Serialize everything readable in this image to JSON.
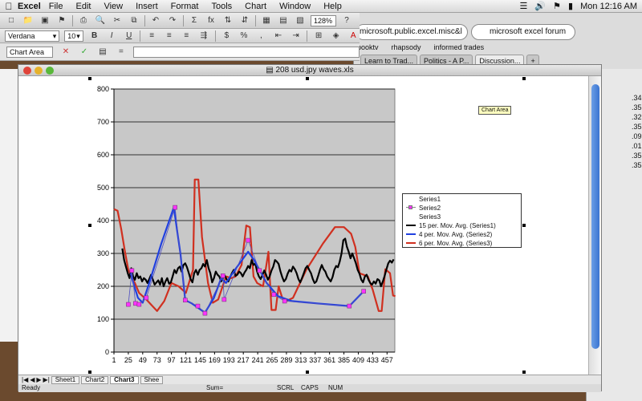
{
  "menubar": {
    "apple": "",
    "app": "Excel",
    "items": [
      "File",
      "Edit",
      "View",
      "Insert",
      "Format",
      "Tools",
      "Chart",
      "Window",
      "Help"
    ],
    "clock": "Mon 12:16 AM"
  },
  "browser": {
    "address": "microsoft.public.excel.misc&l",
    "search": "microsoft excel forum",
    "bookmarks": [
      "booktv",
      "rhapsody",
      "informed trades"
    ],
    "tabs": [
      "Learn to Trad...",
      "Politics - A P...",
      "Discussion..."
    ],
    "side_values": [
      ".34",
      ".35",
      ".32",
      ".35",
      ".09",
      ".01",
      ".35",
      ".35"
    ]
  },
  "toolbar": {
    "font": "Verdana",
    "size": "10",
    "zoom": "128%",
    "bold": "B",
    "italic": "I",
    "underline": "U",
    "sum": "Σ",
    "fx": "fx"
  },
  "formula": {
    "namebox": "Chart Area",
    "value": ""
  },
  "workbook": {
    "title": "208 usd.jpy waves.xls",
    "sheets": [
      "Sheet1",
      "Chart2",
      "Chart3",
      "Shee"
    ],
    "active_sheet": "Chart3",
    "status": "Ready",
    "sum_label": "Sum=",
    "indicators": [
      "SCRL",
      "CAPS",
      "NUM"
    ]
  },
  "chart_data": {
    "type": "line",
    "tooltip": "Chart Area",
    "ylim": [
      0,
      800
    ],
    "yticks": [
      0,
      100,
      200,
      300,
      400,
      500,
      600,
      700,
      800
    ],
    "xticks": [
      1,
      25,
      49,
      73,
      97,
      121,
      145,
      169,
      193,
      217,
      241,
      265,
      289,
      313,
      337,
      361,
      385,
      409,
      433,
      457
    ],
    "xlim": [
      1,
      470
    ],
    "series": [
      {
        "name": "Series1",
        "points": []
      },
      {
        "name": "Series2",
        "marker": "square",
        "color": "#ff33ff",
        "points": [
          [
            25,
            145
          ],
          [
            31,
            248
          ],
          [
            37,
            148
          ],
          [
            43,
            145
          ],
          [
            55,
            165
          ],
          [
            103,
            440
          ],
          [
            120,
            158
          ],
          [
            141,
            140
          ],
          [
            153,
            118
          ],
          [
            183,
            232
          ],
          [
            185,
            160
          ],
          [
            225,
            340
          ],
          [
            244,
            248
          ],
          [
            268,
            175
          ],
          [
            286,
            155
          ],
          [
            394,
            140
          ],
          [
            418,
            185
          ]
        ]
      },
      {
        "name": "Series3",
        "points": []
      },
      {
        "name": "15 per. Mov. Avg. (Series1)",
        "color": "#000000",
        "points": [
          [
            15,
            315
          ],
          [
            18,
            280
          ],
          [
            21,
            260
          ],
          [
            24,
            240
          ],
          [
            27,
            225
          ],
          [
            30,
            255
          ],
          [
            33,
            230
          ],
          [
            36,
            220
          ],
          [
            39,
            240
          ],
          [
            42,
            225
          ],
          [
            45,
            230
          ],
          [
            48,
            215
          ],
          [
            51,
            225
          ],
          [
            54,
            220
          ],
          [
            57,
            210
          ],
          [
            60,
            222
          ],
          [
            63,
            235
          ],
          [
            66,
            220
          ],
          [
            69,
            205
          ],
          [
            72,
            212
          ],
          [
            75,
            218
          ],
          [
            78,
            205
          ],
          [
            81,
            225
          ],
          [
            84,
            200
          ],
          [
            87,
            215
          ],
          [
            90,
            225
          ],
          [
            93,
            208
          ],
          [
            96,
            212
          ],
          [
            99,
            230
          ],
          [
            102,
            250
          ],
          [
            105,
            240
          ],
          [
            108,
            255
          ],
          [
            111,
            260
          ],
          [
            114,
            245
          ],
          [
            117,
            265
          ],
          [
            120,
            270
          ],
          [
            123,
            258
          ],
          [
            126,
            240
          ],
          [
            129,
            222
          ],
          [
            132,
            212
          ],
          [
            135,
            240
          ],
          [
            138,
            250
          ],
          [
            141,
            235
          ],
          [
            144,
            250
          ],
          [
            147,
            255
          ],
          [
            150,
            268
          ],
          [
            153,
            260
          ],
          [
            156,
            280
          ],
          [
            159,
            255
          ],
          [
            162,
            240
          ],
          [
            165,
            212
          ],
          [
            168,
            225
          ],
          [
            171,
            245
          ],
          [
            174,
            235
          ],
          [
            177,
            230
          ],
          [
            180,
            215
          ],
          [
            183,
            225
          ],
          [
            186,
            232
          ],
          [
            189,
            222
          ],
          [
            192,
            215
          ],
          [
            195,
            228
          ],
          [
            198,
            240
          ],
          [
            201,
            250
          ],
          [
            204,
            232
          ],
          [
            207,
            235
          ],
          [
            210,
            245
          ],
          [
            213,
            240
          ],
          [
            216,
            230
          ],
          [
            219,
            242
          ],
          [
            222,
            250
          ],
          [
            225,
            262
          ],
          [
            228,
            255
          ],
          [
            231,
            280
          ],
          [
            234,
            265
          ],
          [
            237,
            270
          ],
          [
            240,
            245
          ],
          [
            243,
            230
          ],
          [
            246,
            222
          ],
          [
            249,
            235
          ],
          [
            252,
            248
          ],
          [
            255,
            235
          ],
          [
            258,
            220
          ],
          [
            261,
            230
          ],
          [
            264,
            248
          ],
          [
            267,
            260
          ],
          [
            270,
            280
          ],
          [
            273,
            275
          ],
          [
            276,
            268
          ],
          [
            279,
            245
          ],
          [
            282,
            228
          ],
          [
            285,
            215
          ],
          [
            288,
            222
          ],
          [
            291,
            238
          ],
          [
            294,
            250
          ],
          [
            297,
            245
          ],
          [
            300,
            260
          ],
          [
            303,
            252
          ],
          [
            306,
            240
          ],
          [
            309,
            222
          ],
          [
            312,
            212
          ],
          [
            315,
            225
          ],
          [
            318,
            240
          ],
          [
            321,
            255
          ],
          [
            324,
            262
          ],
          [
            327,
            250
          ],
          [
            330,
            240
          ],
          [
            333,
            222
          ],
          [
            336,
            210
          ],
          [
            339,
            215
          ],
          [
            342,
            232
          ],
          [
            345,
            250
          ],
          [
            348,
            265
          ],
          [
            351,
            252
          ],
          [
            354,
            245
          ],
          [
            357,
            230
          ],
          [
            360,
            222
          ],
          [
            363,
            215
          ],
          [
            366,
            228
          ],
          [
            369,
            250
          ],
          [
            372,
            262
          ],
          [
            375,
            258
          ],
          [
            378,
            275
          ],
          [
            381,
            300
          ],
          [
            384,
            340
          ],
          [
            387,
            345
          ],
          [
            390,
            320
          ],
          [
            393,
            305
          ],
          [
            396,
            285
          ],
          [
            399,
            300
          ],
          [
            402,
            285
          ],
          [
            405,
            270
          ],
          [
            408,
            250
          ],
          [
            411,
            238
          ],
          [
            414,
            220
          ],
          [
            417,
            212
          ],
          [
            420,
            230
          ],
          [
            423,
            235
          ],
          [
            426,
            220
          ],
          [
            429,
            210
          ],
          [
            432,
            205
          ],
          [
            435,
            215
          ],
          [
            438,
            208
          ],
          [
            441,
            222
          ],
          [
            444,
            218
          ],
          [
            447,
            200
          ],
          [
            450,
            215
          ],
          [
            453,
            232
          ],
          [
            456,
            252
          ],
          [
            459,
            270
          ],
          [
            462,
            278
          ],
          [
            465,
            272
          ],
          [
            468,
            282
          ]
        ]
      },
      {
        "name": "4 per. Mov. Avg. (Series2)",
        "color": "#2040e0",
        "points": [
          [
            29,
            240
          ],
          [
            35,
            200
          ],
          [
            41,
            165
          ],
          [
            49,
            150
          ],
          [
            60,
            210
          ],
          [
            80,
            330
          ],
          [
            101,
            440
          ],
          [
            112,
            300
          ],
          [
            120,
            158
          ],
          [
            131,
            148
          ],
          [
            145,
            130
          ],
          [
            153,
            120
          ],
          [
            168,
            165
          ],
          [
            180,
            225
          ],
          [
            188,
            210
          ],
          [
            205,
            255
          ],
          [
            225,
            305
          ],
          [
            235,
            280
          ],
          [
            256,
            210
          ],
          [
            275,
            170
          ],
          [
            298,
            155
          ],
          [
            340,
            148
          ],
          [
            394,
            140
          ],
          [
            418,
            185
          ]
        ]
      },
      {
        "name": "6 per. Mov. Avg. (Series3)",
        "color": "#d03020",
        "points": [
          [
            1,
            435
          ],
          [
            7,
            430
          ],
          [
            13,
            375
          ],
          [
            19,
            310
          ],
          [
            25,
            250
          ],
          [
            30,
            230
          ],
          [
            36,
            210
          ],
          [
            43,
            180
          ],
          [
            55,
            160
          ],
          [
            73,
            125
          ],
          [
            85,
            155
          ],
          [
            97,
            210
          ],
          [
            109,
            200
          ],
          [
            121,
            180
          ],
          [
            133,
            250
          ],
          [
            136,
            525
          ],
          [
            142,
            525
          ],
          [
            148,
            350
          ],
          [
            158,
            210
          ],
          [
            166,
            150
          ],
          [
            175,
            160
          ],
          [
            188,
            230
          ],
          [
            197,
            225
          ],
          [
            204,
            230
          ],
          [
            214,
            265
          ],
          [
            222,
            385
          ],
          [
            228,
            380
          ],
          [
            234,
            230
          ],
          [
            240,
            210
          ],
          [
            250,
            200
          ],
          [
            259,
            305
          ],
          [
            264,
            128
          ],
          [
            271,
            128
          ],
          [
            276,
            200
          ],
          [
            282,
            165
          ],
          [
            289,
            155
          ],
          [
            300,
            165
          ],
          [
            322,
            250
          ],
          [
            350,
            330
          ],
          [
            370,
            380
          ],
          [
            385,
            380
          ],
          [
            397,
            360
          ],
          [
            404,
            320
          ],
          [
            411,
            240
          ],
          [
            425,
            230
          ],
          [
            433,
            190
          ],
          [
            443,
            125
          ],
          [
            448,
            125
          ],
          [
            454,
            252
          ],
          [
            462,
            240
          ],
          [
            467,
            172
          ],
          [
            471,
            170
          ]
        ]
      }
    ]
  }
}
